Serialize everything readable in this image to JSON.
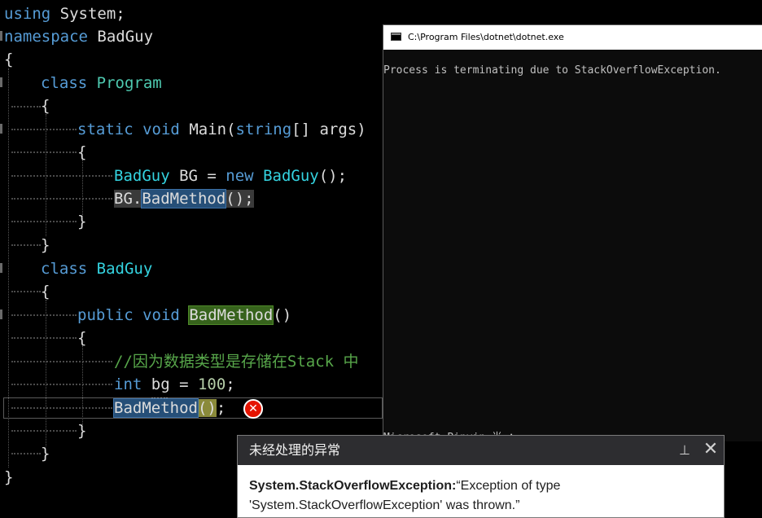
{
  "editor": {
    "lines": {
      "l1_kw": "using",
      "l1_rest": " System;",
      "l2_kw": "namespace",
      "l2_rest": " BadGuy",
      "l3": "{",
      "l4_kw": "class",
      "l4_type": "Program",
      "l5": "{",
      "l6_kw1": "static",
      "l6_kw2": "void",
      "l6_name": "Main",
      "l6_p1": "(",
      "l6_kw3": "string",
      "l6_rest": "[] args)",
      "l7": "{",
      "l8_type1": "BadGuy",
      "l8_mid": " BG = ",
      "l8_kw": "new",
      "l8_type2": "BadGuy",
      "l8_end": "();",
      "l9_obj": "BG.",
      "l9_method": "BadMethod",
      "l9_end": "();",
      "l10": "}",
      "l11": "}",
      "l12_kw": "class",
      "l12_type": "BadGuy",
      "l13": "{",
      "l14_kw1": "public",
      "l14_kw2": "void",
      "l14_method": "BadMethod",
      "l14_end": "()",
      "l15": "{",
      "l16_comment": "//因为数据类型是存储在Stack 中",
      "l17_kw": "int",
      "l17_mid": " bg = ",
      "l17_num": "100",
      "l17_end": ";",
      "l18_method": "BadMethod",
      "l18_paren": "()",
      "l18_end": ";",
      "l19": "}",
      "l20": "}",
      "l21": "}"
    },
    "error_glyph": "✕"
  },
  "console": {
    "title": "C:\\Program Files\\dotnet\\dotnet.exe",
    "output": "Process is terminating due to StackOverflowException.",
    "ime_status": "Microsoft Pinyin 半 ："
  },
  "exception": {
    "title": "未经处理的异常",
    "type": "System.StackOverflowException:",
    "message_part1": "“Exception of type",
    "message_part2": "'System.StackOverflowException' was thrown.”",
    "pin_glyph": "⊥",
    "close_glyph": "✕"
  }
}
